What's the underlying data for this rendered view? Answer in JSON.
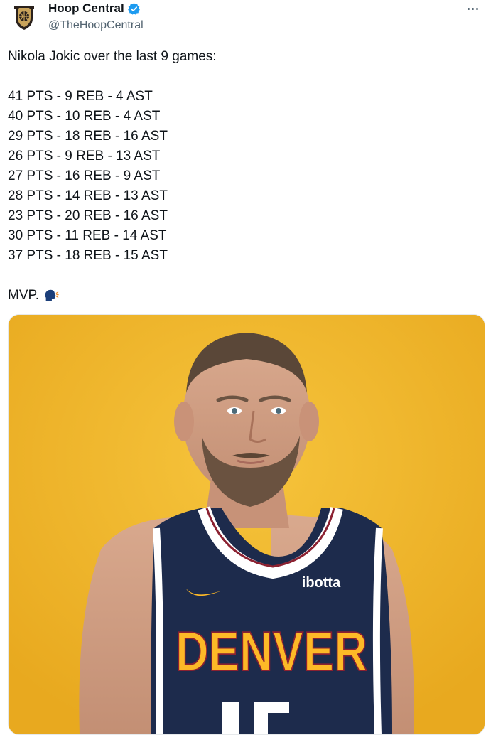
{
  "author": {
    "display_name": "Hoop Central",
    "handle": "@TheHoopCentral",
    "verified": true,
    "avatar_icon": "hoop-central-logo",
    "logo_colors": {
      "primary": "#2a211c",
      "accent": "#c9a35a"
    }
  },
  "tweet": {
    "intro": "Nikola Jokic over the last 9 games:",
    "stat_lines": [
      "41 PTS - 9 REB - 4 AST",
      "40 PTS - 10 REB - 4 AST",
      "29 PTS - 18 REB - 16 AST",
      "26 PTS - 9 REB - 13 AST",
      "27 PTS - 16 REB - 9 AST",
      "28 PTS - 14 REB - 13 AST",
      "23 PTS - 20 REB - 16 AST",
      "30 PTS - 11 REB - 14 AST",
      "37 PTS - 18 REB - 15 AST"
    ],
    "closing": "MVP.",
    "closing_emoji": "speaking-head-emoji"
  },
  "media": {
    "jersey_text": "DENVER",
    "sponsor_text": "ibotta",
    "background_color": "#f0b52a",
    "jersey_color": "#1d2b4c",
    "jersey_lettering_color": "#fdb927"
  },
  "icons": {
    "more": "more-options-icon",
    "verified": "verified-badge-icon"
  },
  "colors": {
    "text_primary": "#0f1419",
    "text_secondary": "#536471",
    "verified_blue": "#1d9bf0"
  }
}
